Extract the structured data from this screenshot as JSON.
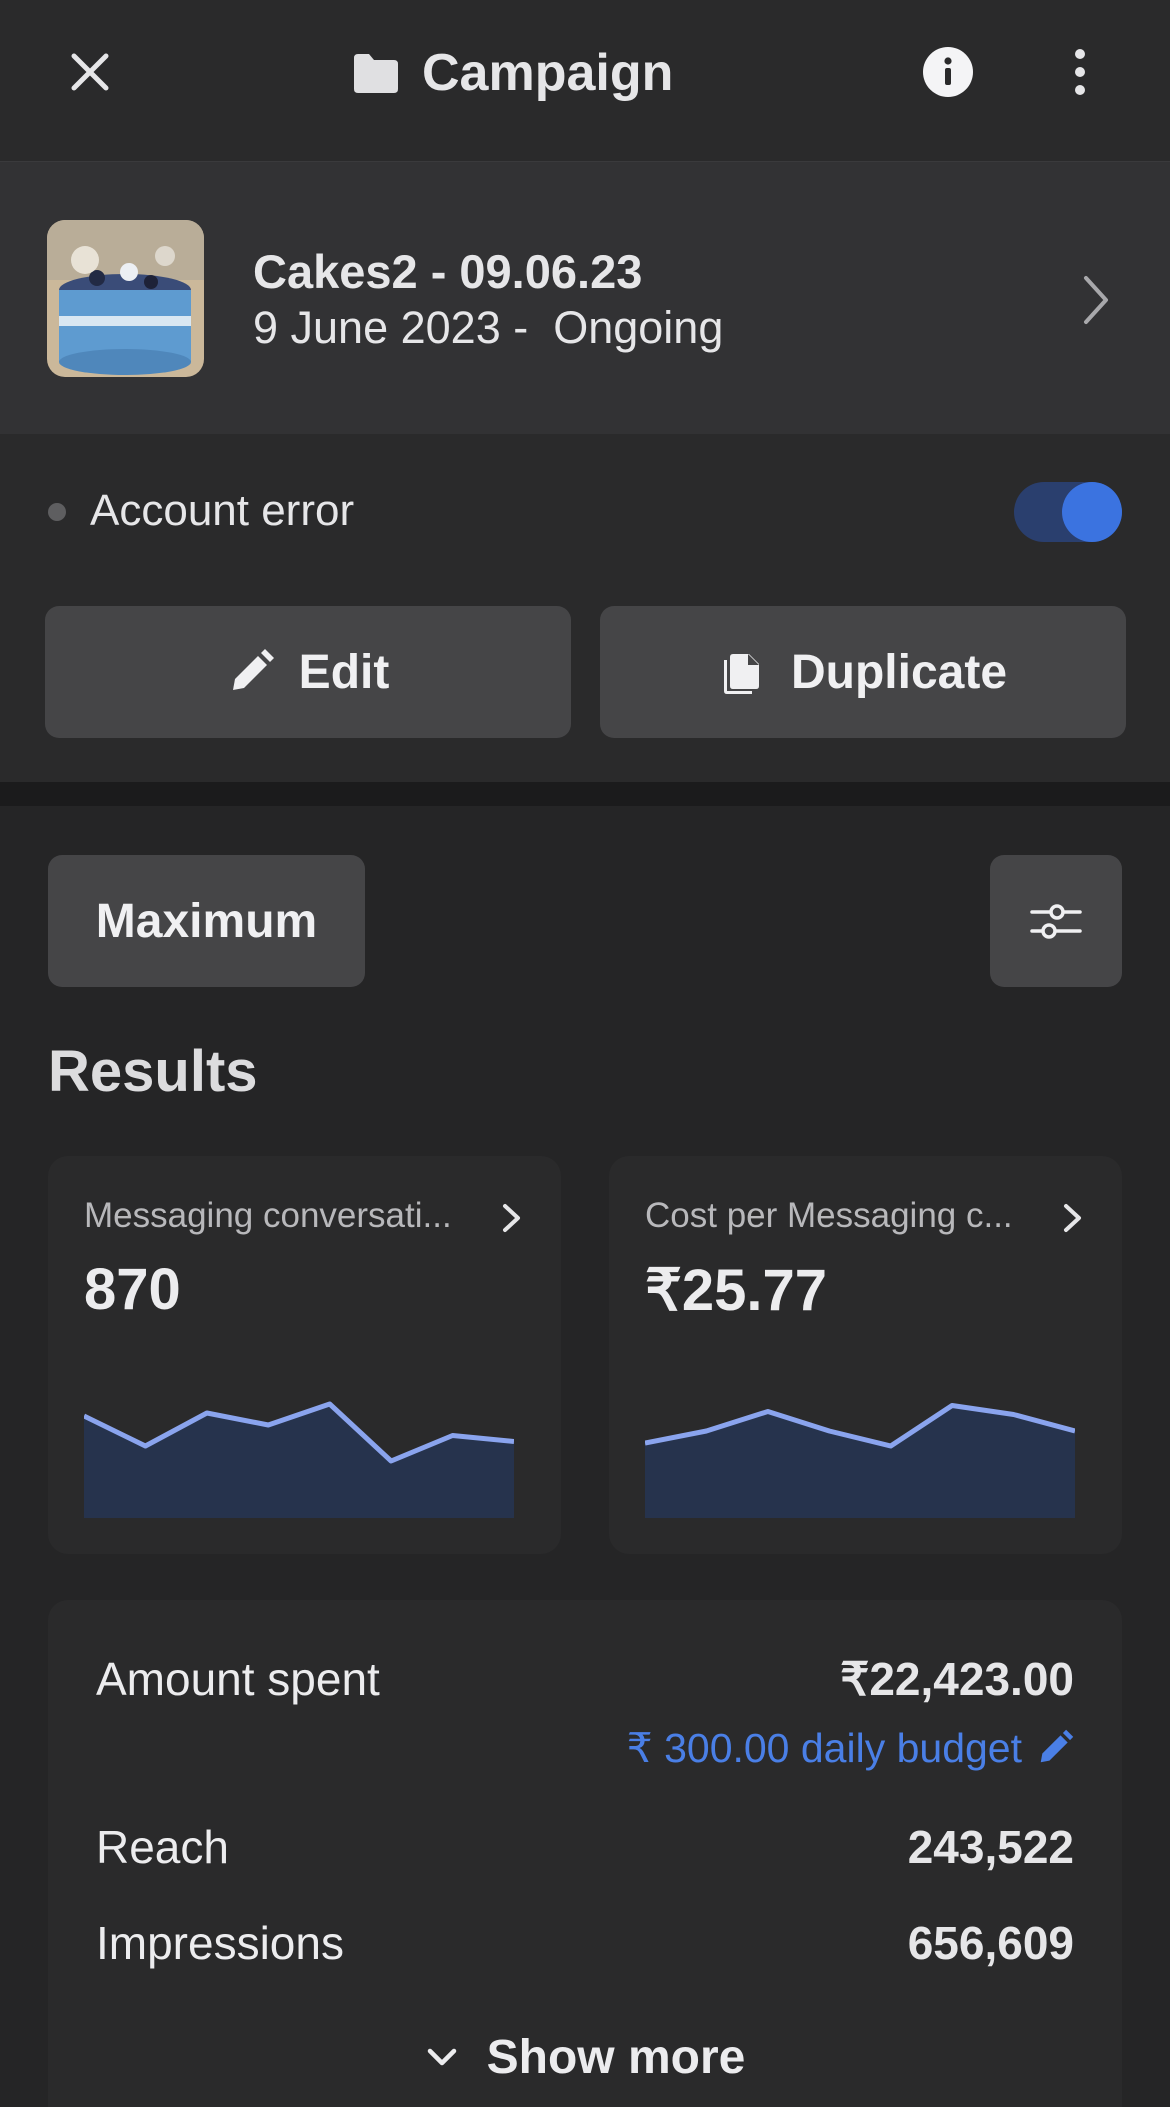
{
  "header": {
    "title": "Campaign",
    "icons": {
      "close": "close-icon",
      "folder": "folder-icon",
      "info": "info-icon",
      "more": "more-vertical-icon"
    }
  },
  "campaign": {
    "name": "Cakes2 - 09.06.23",
    "date_range": "9 June 2023 -  Ongoing",
    "thumbnail": "cake-image"
  },
  "status": {
    "text": "Account error",
    "toggle_on": true,
    "accent_color": "#3b73e0"
  },
  "actions": {
    "edit_label": "Edit",
    "duplicate_label": "Duplicate"
  },
  "filter": {
    "date_preset": "Maximum",
    "filter_icon": "sliders-icon"
  },
  "results": {
    "title": "Results",
    "metrics": [
      {
        "label": "Messaging conversati...",
        "value": "870",
        "trend": [
          0.68,
          0.48,
          0.7,
          0.62,
          0.76,
          0.38,
          0.55,
          0.51
        ]
      },
      {
        "label": "Cost per Messaging c...",
        "value": "₹25.77",
        "trend": [
          0.5,
          0.58,
          0.71,
          0.58,
          0.48,
          0.75,
          0.69,
          0.58
        ]
      }
    ]
  },
  "summary": {
    "amount_spent_label": "Amount spent",
    "amount_spent_value": "₹22,423.00",
    "daily_budget": "₹ 300.00 daily budget",
    "reach_label": "Reach",
    "reach_value": "243,522",
    "impressions_label": "Impressions",
    "impressions_value": "656,609",
    "show_more_label": "Show more"
  }
}
